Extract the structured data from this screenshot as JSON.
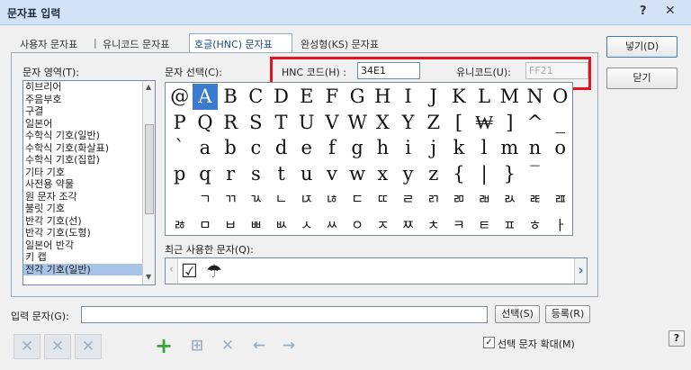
{
  "window": {
    "title": "문자표 입력",
    "help_label": "?",
    "close_label": "✕"
  },
  "tabs": [
    {
      "label": "사용자 문자표"
    },
    {
      "label": "|"
    },
    {
      "label": "유니코드 문자표"
    },
    {
      "label": "호글(HNC) 문자표"
    },
    {
      "label": "완성형(KS) 문자표"
    }
  ],
  "buttons": {
    "insert": "넣기(D)",
    "close": "닫기",
    "select": "선택(S)",
    "register": "등록(R)"
  },
  "area": {
    "label": "문자 영역(T):",
    "items": [
      "히브리어",
      "주음부호",
      "구결",
      "일본어",
      "수학식 기호(일반)",
      "수학식 기호(화살표)",
      "수학식 기호(집합)",
      "기타 기호",
      "사전용 약물",
      "원 문자 조각",
      "불릿 기호",
      "반각 기호(선)",
      "반각 기호(도형)",
      "일본어 반각",
      "키 캡",
      "전각 기호(일반)"
    ],
    "selected_index": 15
  },
  "selection": {
    "label": "문자 선택(C):",
    "hnc_label": "HNC 코드(H) :",
    "hnc_value": "34E1",
    "unicode_label": "유니코드(U):",
    "unicode_value": "FF21"
  },
  "grid": {
    "rows": [
      [
        "@",
        "A",
        "B",
        "C",
        "D",
        "E",
        "F",
        "G",
        "H",
        "I",
        "J",
        "K",
        "L",
        "M",
        "N",
        "O"
      ],
      [
        "P",
        "Q",
        "R",
        "S",
        "T",
        "U",
        "V",
        "W",
        "X",
        "Y",
        "Z",
        "[",
        "₩",
        "]",
        "^",
        "_"
      ],
      [
        "`",
        "a",
        "b",
        "c",
        "d",
        "e",
        "f",
        "g",
        "h",
        "i",
        "j",
        "k",
        "l",
        "m",
        "n",
        "o"
      ],
      [
        "p",
        "q",
        "r",
        "s",
        "t",
        "u",
        "v",
        "w",
        "x",
        "y",
        "z",
        "{",
        "|",
        "}",
        "‾",
        ""
      ],
      [
        "",
        "ㄱ",
        "ㄲ",
        "ㄳ",
        "ㄴ",
        "ㄵ",
        "ㄶ",
        "ㄷ",
        "ㄸ",
        "ㄹ",
        "ㄺ",
        "ㄻ",
        "ㄼ",
        "ㄽ",
        "ㄾ",
        "ㄿ"
      ],
      [
        "ㅀ",
        "ㅁ",
        "ㅂ",
        "ㅃ",
        "ㅄ",
        "ㅅ",
        "ㅆ",
        "ㅇ",
        "ㅈ",
        "ㅉ",
        "ㅊ",
        "ㅋ",
        "ㅌ",
        "ㅍ",
        "ㅎ",
        "ㅏ"
      ]
    ],
    "selected": [
      0,
      1
    ]
  },
  "recent": {
    "label": "최근 사용한 문자(Q):",
    "chars": [
      "☑",
      "☂"
    ]
  },
  "input": {
    "label": "입력 문자(G):",
    "value": ""
  },
  "enlarge": {
    "label": "선택 문자 확대(M)",
    "checked": true
  },
  "help_button": "?"
}
